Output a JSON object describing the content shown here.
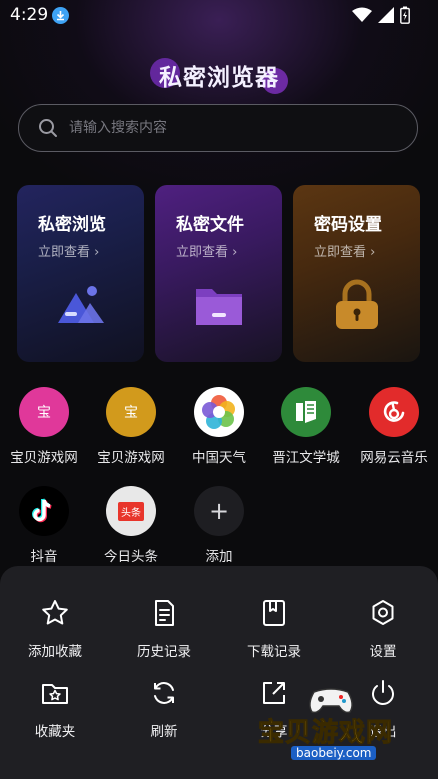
{
  "status_bar": {
    "time": "4:29"
  },
  "app": {
    "title": "私密浏览器"
  },
  "search": {
    "placeholder": "请输入搜索内容"
  },
  "cards": [
    {
      "title": "私密浏览",
      "subtitle": "立即查看 ›",
      "icon": "mountain-icon"
    },
    {
      "title": "私密文件",
      "subtitle": "立即查看 ›",
      "icon": "folder-icon"
    },
    {
      "title": "密码设置",
      "subtitle": "立即查看 ›",
      "icon": "lock-icon"
    }
  ],
  "shortcuts": [
    {
      "label": "宝贝游戏网",
      "glyph": "宝",
      "color": "#e0389a"
    },
    {
      "label": "宝贝游戏网",
      "glyph": "宝",
      "color": "#d29a1c"
    },
    {
      "label": "中国天气",
      "icon": "weather-icon"
    },
    {
      "label": "晋江文学城",
      "icon": "jinjiang-icon",
      "color": "#2e8a3a"
    },
    {
      "label": "网易云音乐",
      "icon": "netease-music-icon",
      "color": "#e22b2b"
    },
    {
      "label": "抖音",
      "icon": "douyin-icon"
    },
    {
      "label": "今日头条",
      "glyph": "头条",
      "color": "#e8e8e8"
    },
    {
      "label": "添加",
      "glyph": "+"
    }
  ],
  "menu": {
    "add_bookmark": "添加收藏",
    "history": "历史记录",
    "downloads": "下载记录",
    "settings": "设置",
    "favorites": "收藏夹",
    "refresh": "刷新",
    "share": "分享",
    "exit": "退出"
  },
  "watermark": {
    "text": "宝贝游戏网",
    "url": "baobeiy.com"
  }
}
